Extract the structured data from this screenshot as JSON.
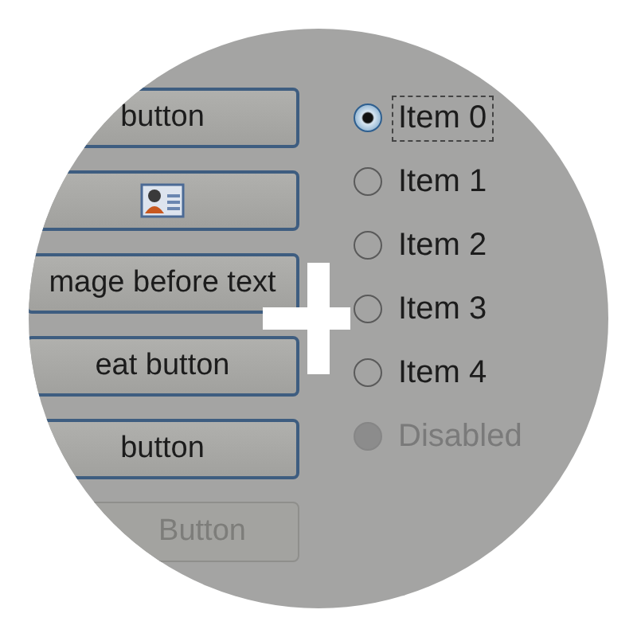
{
  "buttons": [
    {
      "kind": "text",
      "label": "button",
      "disabled": false
    },
    {
      "kind": "icon",
      "disabled": false
    },
    {
      "kind": "text",
      "label": "mage before text",
      "disabled": false
    },
    {
      "kind": "text",
      "label": "eat button",
      "disabled": false
    },
    {
      "kind": "text",
      "label": "button",
      "disabled": false
    },
    {
      "kind": "text",
      "label": "Button",
      "disabled": true
    }
  ],
  "radios": [
    {
      "label": "Item 0",
      "selected": true,
      "focused": true,
      "disabled": false
    },
    {
      "label": "Item 1",
      "selected": false,
      "focused": false,
      "disabled": false
    },
    {
      "label": "Item 2",
      "selected": false,
      "focused": false,
      "disabled": false
    },
    {
      "label": "Item 3",
      "selected": false,
      "focused": false,
      "disabled": false
    },
    {
      "label": "Item 4",
      "selected": false,
      "focused": false,
      "disabled": false
    },
    {
      "label": "Disabled",
      "selected": false,
      "focused": false,
      "disabled": true
    }
  ]
}
